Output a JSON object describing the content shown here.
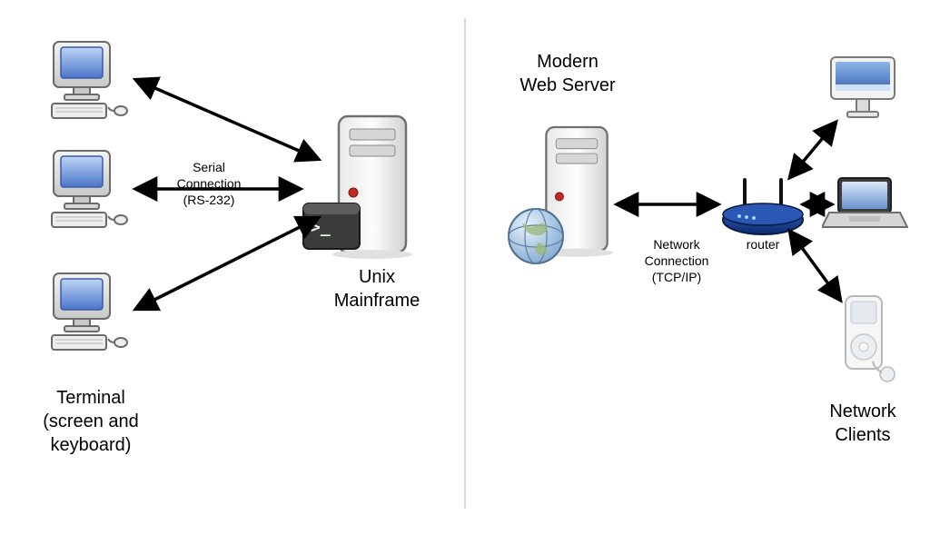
{
  "left": {
    "title": "Unix\nMainframe",
    "terminal_label": "Terminal\n(screen and\nkeyboard)",
    "connection_label": "Serial\nConnection\n(RS-232)"
  },
  "right": {
    "title": "Modern\nWeb Server",
    "clients_label": "Network\nClients",
    "connection_label": "Network\nConnection\n(TCP/IP)",
    "router_label": "router"
  },
  "icons": {
    "terminal": "crt-terminal-icon",
    "server": "server-tower-icon",
    "console": "terminal-console-icon",
    "globe": "globe-icon",
    "router": "router-icon",
    "imac": "imac-icon",
    "laptop": "laptop-icon",
    "mp3": "mp3-player-icon"
  }
}
